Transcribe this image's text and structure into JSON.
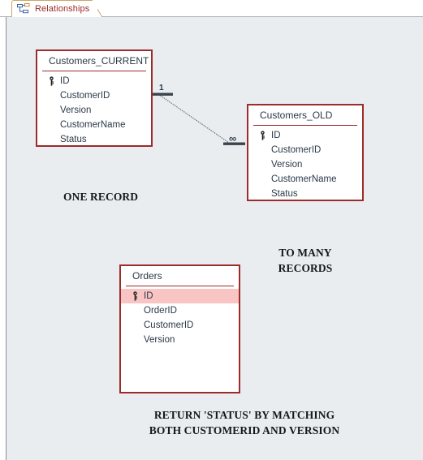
{
  "window": {
    "tab": {
      "label": "Relationships",
      "icon": "relationships-diagram-icon"
    },
    "canvas_background": "#e9edf0"
  },
  "colors": {
    "table_border": "#9c2b2b",
    "table_fill": "#ffffff",
    "field_text": "#2b3947",
    "selected_row": "#f9c4c4",
    "tab_text": "#9c2b2b",
    "annotation_text": "#16181c"
  },
  "tables": [
    {
      "id": "customers-current",
      "title": "Customers_CURRENT",
      "fields": [
        {
          "name": "ID",
          "key": true,
          "selected": false
        },
        {
          "name": "CustomerID",
          "key": false,
          "selected": false
        },
        {
          "name": "Version",
          "key": false,
          "selected": false
        },
        {
          "name": "CustomerName",
          "key": false,
          "selected": false
        },
        {
          "name": "Status",
          "key": false,
          "selected": false
        }
      ]
    },
    {
      "id": "customers-old",
      "title": "Customers_OLD",
      "fields": [
        {
          "name": "ID",
          "key": true,
          "selected": false
        },
        {
          "name": "CustomerID",
          "key": false,
          "selected": false
        },
        {
          "name": "Version",
          "key": false,
          "selected": false
        },
        {
          "name": "CustomerName",
          "key": false,
          "selected": false
        },
        {
          "name": "Status",
          "key": false,
          "selected": false
        }
      ]
    },
    {
      "id": "orders",
      "title": "Orders",
      "fields": [
        {
          "name": "ID",
          "key": true,
          "selected": true
        },
        {
          "name": "OrderID",
          "key": false,
          "selected": false
        },
        {
          "name": "CustomerID",
          "key": false,
          "selected": false
        },
        {
          "name": "Version",
          "key": false,
          "selected": false
        }
      ]
    }
  ],
  "relationship": {
    "one_label": "1",
    "many_label": "∞",
    "from_table": "customers-current",
    "to_table": "customers-old"
  },
  "annotations": [
    {
      "id": "one-record",
      "text": "ONE RECORD"
    },
    {
      "id": "to-many-records",
      "text": "TO MANY\nRECORDS"
    },
    {
      "id": "return-status",
      "text": "RETURN 'STATUS' BY MATCHING\nBOTH CUSTOMERID AND VERSION"
    }
  ]
}
